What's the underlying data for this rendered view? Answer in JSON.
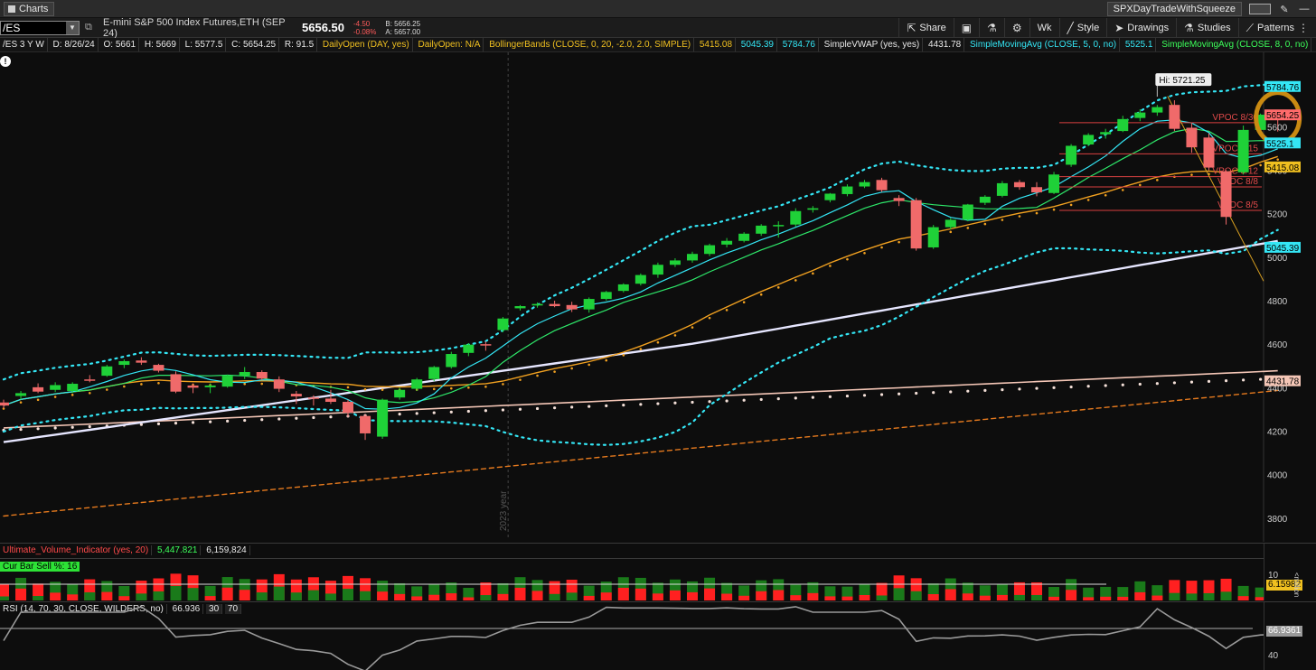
{
  "window": {
    "tab_label": "Charts",
    "account_name": "SPXDayTradeWithSqueeze"
  },
  "toolbar": {
    "symbol": "/ES",
    "description": "E-mini S&P 500 Index Futures,ETH (SEP 24)",
    "last_price": "5656.50",
    "net_change": "-4.50",
    "pct_change": "-0.08%",
    "bid": "B: 5656.25",
    "ask": "A: 5657.00",
    "share_label": "Share",
    "period_label": "Wk",
    "style_label": "Style",
    "drawings_label": "Drawings",
    "studies_label": "Studies",
    "patterns_label": "Patterns"
  },
  "study_row": {
    "timeframe": "/ES 3 Y W",
    "date": "D: 8/26/24",
    "open": "O: 5661",
    "high": "H: 5669",
    "low": "L: 5577.5",
    "close": "C: 5654.25",
    "range": "R: 91.5",
    "daily_open_1": "DailyOpen (DAY, yes)",
    "daily_open_2": "DailyOpen: N/A",
    "bollinger": "BollingerBands (CLOSE, 0, 20, -2.0, 2.0, SIMPLE)",
    "bb_mid": "5415.08",
    "bb_low": "5045.39",
    "bb_high": "5784.76",
    "vwap": "SimpleVWAP (yes, yes)",
    "vwap_val": "4431.78",
    "sma5": "SimpleMovingAvg (CLOSE, 5, 0, no)",
    "sma5_val": "5525.1",
    "sma8": "SimpleMovingAvg (CLOSE, 8, 0, no)",
    "more": "..."
  },
  "price_axis": {
    "ticks": [
      "5600",
      "5400",
      "5200",
      "5000",
      "4800",
      "4600",
      "4400",
      "4200",
      "4000",
      "3800"
    ],
    "badges": [
      {
        "text": "5784.76",
        "bg": "#34e6f5"
      },
      {
        "text": "5654.25",
        "bg": "#ff6b6b"
      },
      {
        "text": "5525.1",
        "bg": "#34e6f5"
      },
      {
        "text": "5415.08",
        "bg": "#f0c020"
      },
      {
        "text": "5045.39",
        "bg": "#34e6f5"
      },
      {
        "text": "4431.78",
        "bg": "#f4c6b6"
      }
    ]
  },
  "annotations": {
    "hi_label": "Hi: 5721.25",
    "year_marker": "2023 year",
    "vpoc": [
      "VPOC 8/30",
      "VPOC 8/15",
      "VPOC 8/12",
      "VPOC 8/8",
      "VPOC 8/5"
    ]
  },
  "volume_pane": {
    "title": "Ultimate_Volume_Indicator (yes, 20)",
    "val1": "5,447.821",
    "val2": "6,159,824",
    "cur_bar": "Cur Bar Sell %: 16",
    "axis_top": "10",
    "axis_badge": "6.15982",
    "axis_unit": "<million"
  },
  "rsi_pane": {
    "title": "RSI (14, 70, 30, CLOSE, WILDERS, no)",
    "value": "66.936",
    "level30": "30",
    "level70": "70",
    "axis_badge": "66.9361",
    "axis_40": "40"
  },
  "colors": {
    "bull": "#1fd138",
    "bear": "#f06a6a",
    "bb": "#34e6f5",
    "sma5": "#34e6f5",
    "sma8": "#2ee86a",
    "sma20": "#f0a020",
    "sma50": "#e6e6ff",
    "sma200": "#f4c6b6",
    "dashed_orange": "#e67a1e",
    "vpoc": "#d94040",
    "circle": "#c98a12"
  },
  "chart_data": {
    "type": "candlestick",
    "symbol": "/ES",
    "period": "weekly",
    "candles": [
      {
        "o": 4332,
        "h": 4345,
        "l": 4305,
        "c": 4318
      },
      {
        "o": 4362,
        "h": 4385,
        "l": 4345,
        "c": 4375
      },
      {
        "o": 4402,
        "h": 4420,
        "l": 4375,
        "c": 4382
      },
      {
        "o": 4390,
        "h": 4425,
        "l": 4380,
        "c": 4412
      },
      {
        "o": 4385,
        "h": 4425,
        "l": 4375,
        "c": 4418
      },
      {
        "o": 4438,
        "h": 4458,
        "l": 4425,
        "c": 4432
      },
      {
        "o": 4455,
        "h": 4505,
        "l": 4450,
        "c": 4498
      },
      {
        "o": 4505,
        "h": 4530,
        "l": 4490,
        "c": 4522
      },
      {
        "o": 4525,
        "h": 4540,
        "l": 4505,
        "c": 4515
      },
      {
        "o": 4505,
        "h": 4510,
        "l": 4470,
        "c": 4478
      },
      {
        "o": 4462,
        "h": 4475,
        "l": 4375,
        "c": 4382
      },
      {
        "o": 4410,
        "h": 4420,
        "l": 4375,
        "c": 4400
      },
      {
        "o": 4402,
        "h": 4420,
        "l": 4375,
        "c": 4410
      },
      {
        "o": 4405,
        "h": 4460,
        "l": 4400,
        "c": 4455
      },
      {
        "o": 4455,
        "h": 4495,
        "l": 4440,
        "c": 4472
      },
      {
        "o": 4472,
        "h": 4480,
        "l": 4435,
        "c": 4442
      },
      {
        "o": 4438,
        "h": 4452,
        "l": 4380,
        "c": 4395
      },
      {
        "o": 4372,
        "h": 4385,
        "l": 4325,
        "c": 4360
      },
      {
        "o": 4355,
        "h": 4365,
        "l": 4318,
        "c": 4350
      },
      {
        "o": 4350,
        "h": 4390,
        "l": 4325,
        "c": 4335
      },
      {
        "o": 4335,
        "h": 4345,
        "l": 4265,
        "c": 4285
      },
      {
        "o": 4270,
        "h": 4278,
        "l": 4160,
        "c": 4190
      },
      {
        "o": 4175,
        "h": 4350,
        "l": 4165,
        "c": 4345
      },
      {
        "o": 4355,
        "h": 4400,
        "l": 4345,
        "c": 4390
      },
      {
        "o": 4395,
        "h": 4445,
        "l": 4385,
        "c": 4438
      },
      {
        "o": 4440,
        "h": 4500,
        "l": 4430,
        "c": 4495
      },
      {
        "o": 4495,
        "h": 4565,
        "l": 4488,
        "c": 4555
      },
      {
        "o": 4560,
        "h": 4605,
        "l": 4545,
        "c": 4598
      },
      {
        "o": 4600,
        "h": 4612,
        "l": 4570,
        "c": 4595
      },
      {
        "o": 4665,
        "h": 4725,
        "l": 4655,
        "c": 4718
      },
      {
        "o": 4765,
        "h": 4780,
        "l": 4755,
        "c": 4775
      },
      {
        "o": 4778,
        "h": 4792,
        "l": 4768,
        "c": 4785
      },
      {
        "o": 4785,
        "h": 4800,
        "l": 4770,
        "c": 4775
      },
      {
        "o": 4780,
        "h": 4795,
        "l": 4748,
        "c": 4760
      },
      {
        "o": 4760,
        "h": 4815,
        "l": 4745,
        "c": 4808
      },
      {
        "o": 4808,
        "h": 4845,
        "l": 4800,
        "c": 4840
      },
      {
        "o": 4845,
        "h": 4880,
        "l": 4838,
        "c": 4875
      },
      {
        "o": 4878,
        "h": 4925,
        "l": 4870,
        "c": 4918
      },
      {
        "o": 4920,
        "h": 4975,
        "l": 4905,
        "c": 4965
      },
      {
        "o": 4965,
        "h": 4995,
        "l": 4955,
        "c": 4985
      },
      {
        "o": 4985,
        "h": 5025,
        "l": 4975,
        "c": 5015
      },
      {
        "o": 5015,
        "h": 5062,
        "l": 5005,
        "c": 5055
      },
      {
        "o": 5058,
        "h": 5088,
        "l": 5045,
        "c": 5075
      },
      {
        "o": 5075,
        "h": 5115,
        "l": 5068,
        "c": 5108
      },
      {
        "o": 5108,
        "h": 5152,
        "l": 5098,
        "c": 5145
      },
      {
        "o": 5145,
        "h": 5165,
        "l": 5090,
        "c": 5148
      },
      {
        "o": 5150,
        "h": 5225,
        "l": 5140,
        "c": 5212
      },
      {
        "o": 5218,
        "h": 5235,
        "l": 5205,
        "c": 5225
      },
      {
        "o": 5262,
        "h": 5295,
        "l": 5252,
        "c": 5292
      },
      {
        "o": 5290,
        "h": 5335,
        "l": 5280,
        "c": 5325
      },
      {
        "o": 5325,
        "h": 5355,
        "l": 5318,
        "c": 5345
      },
      {
        "o": 5355,
        "h": 5365,
        "l": 5300,
        "c": 5308
      },
      {
        "o": 5272,
        "h": 5285,
        "l": 5235,
        "c": 5258
      },
      {
        "o": 5262,
        "h": 5272,
        "l": 5030,
        "c": 5040
      },
      {
        "o": 5045,
        "h": 5148,
        "l": 5038,
        "c": 5138
      },
      {
        "o": 5138,
        "h": 5180,
        "l": 5128,
        "c": 5172
      },
      {
        "o": 5172,
        "h": 5245,
        "l": 5165,
        "c": 5242
      },
      {
        "o": 5250,
        "h": 5285,
        "l": 5240,
        "c": 5278
      },
      {
        "o": 5282,
        "h": 5350,
        "l": 5275,
        "c": 5340
      },
      {
        "o": 5345,
        "h": 5355,
        "l": 5310,
        "c": 5322
      },
      {
        "o": 5322,
        "h": 5345,
        "l": 5280,
        "c": 5298
      },
      {
        "o": 5295,
        "h": 5392,
        "l": 5290,
        "c": 5380
      },
      {
        "o": 5425,
        "h": 5520,
        "l": 5415,
        "c": 5512
      },
      {
        "o": 5518,
        "h": 5570,
        "l": 5510,
        "c": 5562
      },
      {
        "o": 5565,
        "h": 5590,
        "l": 5545,
        "c": 5575
      },
      {
        "o": 5580,
        "h": 5650,
        "l": 5575,
        "c": 5635
      },
      {
        "o": 5640,
        "h": 5680,
        "l": 5625,
        "c": 5665
      },
      {
        "o": 5665,
        "h": 5700,
        "l": 5650,
        "c": 5690
      },
      {
        "o": 5700,
        "h": 5721.25,
        "l": 5580,
        "c": 5590
      },
      {
        "o": 5595,
        "h": 5615,
        "l": 5480,
        "c": 5505
      },
      {
        "o": 5550,
        "h": 5570,
        "l": 5400,
        "c": 5412
      },
      {
        "o": 5395,
        "h": 5400,
        "l": 5150,
        "c": 5185
      },
      {
        "o": 5390,
        "h": 5605,
        "l": 5380,
        "c": 5585
      },
      {
        "o": 5585,
        "h": 5660,
        "l": 5570,
        "c": 5655
      },
      {
        "o": 5661,
        "h": 5669,
        "l": 5577.5,
        "c": 5654.25
      }
    ],
    "vpoc_levels": [
      {
        "label": "VPOC 8/30",
        "price": 5618
      },
      {
        "label": "VPOC 8/15",
        "price": 5475
      },
      {
        "label": "VPOC 8/12",
        "price": 5370
      },
      {
        "label": "VPOC 8/8",
        "price": 5323
      },
      {
        "label": "VPOC 8/5",
        "price": 5215
      }
    ],
    "y_range": [
      3700,
      5900
    ]
  }
}
